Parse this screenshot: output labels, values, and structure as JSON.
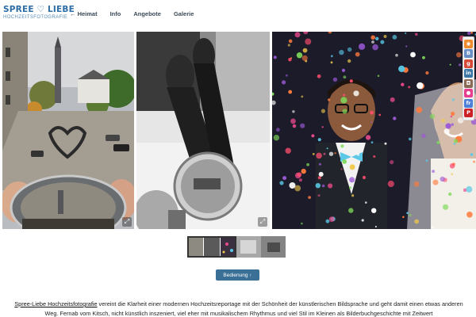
{
  "header": {
    "logo_main": "SPREE ♡ LIEBE",
    "logo_sub": "HOCHZEITSFOTOGRAFIE",
    "nav": [
      {
        "label": "← Heimat"
      },
      {
        "label": "Info"
      },
      {
        "label": "Angebote"
      },
      {
        "label": "Galerie"
      }
    ]
  },
  "social": [
    {
      "icon": "rss-icon",
      "glyph": "◉",
      "color": "#ef8b2c"
    },
    {
      "icon": "blog-icon",
      "glyph": "B",
      "color": "#6a8fc6"
    },
    {
      "icon": "google-plus-icon",
      "glyph": "g",
      "color": "#d64a3a"
    },
    {
      "icon": "linkedin-icon",
      "glyph": "in",
      "color": "#3b78a8"
    },
    {
      "icon": "instagram-icon",
      "glyph": "◘",
      "color": "#8a6a55"
    },
    {
      "icon": "flickr-icon",
      "glyph": "●",
      "color": "#e63d8f"
    },
    {
      "icon": "friendfeed-icon",
      "glyph": "fr",
      "color": "#4c7fd6"
    },
    {
      "icon": "pinterest-icon",
      "glyph": "P",
      "color": "#cc2127"
    }
  ],
  "gallery": {
    "expand_glyph": "⤢"
  },
  "controls": {
    "bedienung_label": "Bedienung ↑"
  },
  "intro": {
    "link_text": "Spree-Liebe Hochzeitsfotografie",
    "text": " vereint die Klarheit einer modernen Hochzeitsreportage mit der Schönheit der künstlerischen Bildsprache und geht damit einen etwas anderen Weg. Fernab vom Kitsch, nicht künstlich inszeniert, viel eher mit musikalischem Rhythmus und viel Stil im Kleinen als Bilderbuchgeschichte mit Zeitwert"
  },
  "colors": {
    "accent": "#2d6ea6",
    "button": "#3a6f96"
  }
}
